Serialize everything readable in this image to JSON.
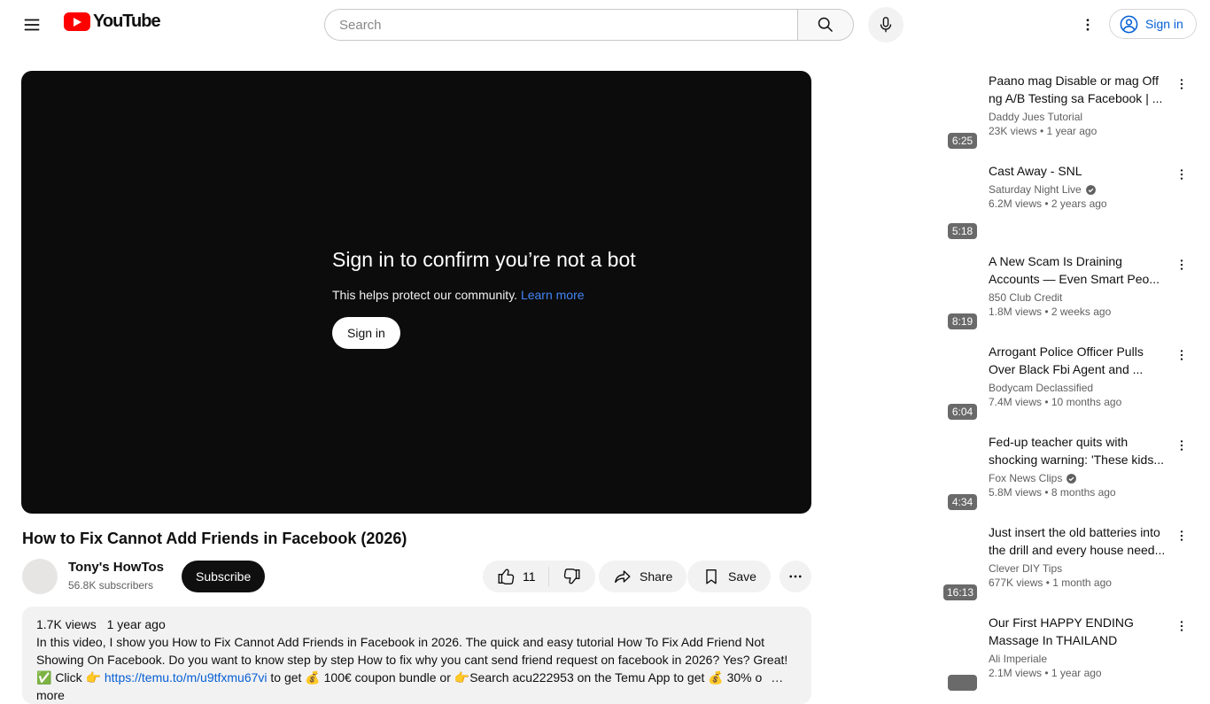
{
  "header": {
    "logo_label": "YouTube",
    "search_placeholder": "Search",
    "signin_label": "Sign in"
  },
  "player": {
    "headline": "Sign in to confirm you’re not a bot",
    "subtext": "This helps protect our community.",
    "learn_more_label": "Learn more",
    "signin_label": "Sign in"
  },
  "video": {
    "title": "How to Fix Cannot Add Friends in Facebook (2026)",
    "channel_name": "Tony's HowTos",
    "subscriber_count": "56.8K subscribers",
    "subscribe_label": "Subscribe",
    "like_count": "11",
    "share_label": "Share",
    "save_label": "Save"
  },
  "description": {
    "views": "1.7K views",
    "age": "1 year ago",
    "text": "In this video, I show you How to Fix Cannot Add Friends in Facebook in 2026. The quick and easy tutorial How To Fix Add Friend Not Showing On Facebook. Do you want to know step by step How to fix why you cant send friend request on facebook in 2026? Yes? Great!",
    "cta_prefix": "✅ Click 👉 ",
    "cta_link": "https://temu.to/m/u9tfxmu67vi",
    "cta_suffix": " to get 💰 100€ coupon bundle or 👉Search acu222953 on the Temu App to get 💰 30% o",
    "more_label": "…more"
  },
  "sidebar": {
    "videos": [
      {
        "title": "Paano mag Disable or mag Off ng A/B Testing sa Facebook | ...",
        "channel": "Daddy Jues Tutorial",
        "verified": false,
        "meta": "23K views • 1 year ago",
        "duration": "6:25"
      },
      {
        "title": "Cast Away - SNL",
        "channel": "Saturday Night Live",
        "verified": true,
        "meta": "6.2M views • 2 years ago",
        "duration": "5:18"
      },
      {
        "title": "A New Scam Is Draining Accounts — Even Smart Peo...",
        "channel": "850 Club Credit",
        "verified": false,
        "meta": "1.8M views • 2 weeks ago",
        "duration": "8:19"
      },
      {
        "title": "Arrogant Police Officer Pulls Over Black Fbi Agent and ...",
        "channel": "Bodycam Declassified",
        "verified": false,
        "meta": "7.4M views • 10 months ago",
        "duration": "6:04"
      },
      {
        "title": "Fed-up teacher quits with shocking warning: 'These kids...",
        "channel": "Fox News Clips",
        "verified": true,
        "meta": "5.8M views • 8 months ago",
        "duration": "4:34"
      },
      {
        "title": "Just insert the old batteries into the drill and every house need...",
        "channel": "Clever DIY Tips",
        "verified": false,
        "meta": "677K views • 1 month ago",
        "duration": "16:13"
      },
      {
        "title": "Our First HAPPY ENDING Massage In THAILAND",
        "channel": "Ali Imperiale",
        "verified": false,
        "meta": "2.1M views • 1 year ago",
        "duration": ""
      }
    ]
  },
  "colors": {
    "brand_red": "#ff0000",
    "link_blue": "#065fd4",
    "player_link_blue": "#4285f4",
    "badge_gray": "#6a6a6a"
  }
}
